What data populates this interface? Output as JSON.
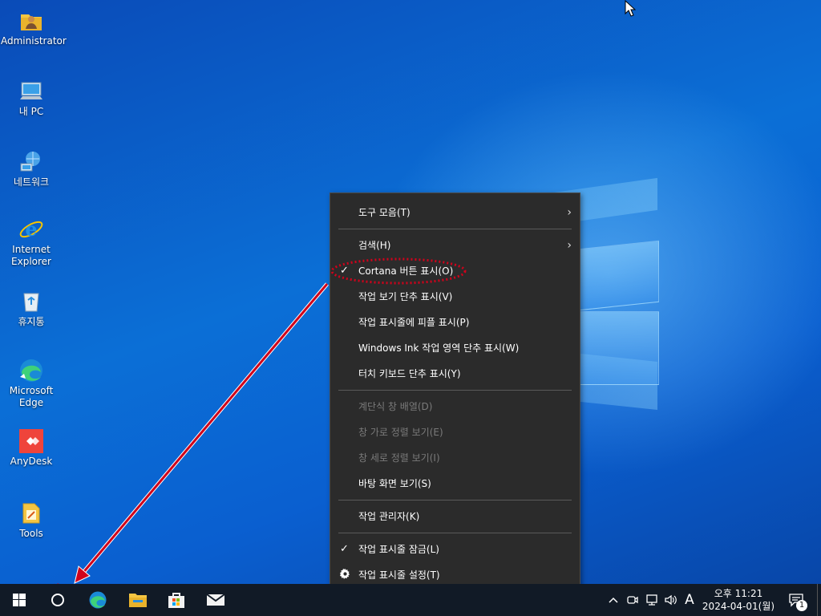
{
  "desktop": {
    "icons": [
      {
        "label_line1": "Administrator",
        "label_line2": "",
        "icon": "user-folder-icon"
      },
      {
        "label_line1": "내 PC",
        "label_line2": "",
        "icon": "computer-icon"
      },
      {
        "label_line1": "네트워크",
        "label_line2": "",
        "icon": "network-icon"
      },
      {
        "label_line1": "Internet",
        "label_line2": "Explorer",
        "icon": "internet-explorer-icon"
      },
      {
        "label_line1": "휴지통",
        "label_line2": "",
        "icon": "recycle-bin-icon"
      },
      {
        "label_line1": "Microsoft",
        "label_line2": "Edge",
        "icon": "edge-icon"
      },
      {
        "label_line1": "AnyDesk",
        "label_line2": "",
        "icon": "anydesk-icon"
      },
      {
        "label_line1": "Tools",
        "label_line2": "",
        "icon": "tools-folder-icon"
      }
    ]
  },
  "context_menu": {
    "items": [
      {
        "label": "도구 모음(T)",
        "submenu": true,
        "disabled": false,
        "checked": false
      },
      {
        "label": "검색(H)",
        "submenu": true,
        "disabled": false,
        "checked": false
      },
      {
        "label": "Cortana 버튼 표시(O)",
        "submenu": false,
        "disabled": false,
        "checked": true
      },
      {
        "label": "작업 보기 단추 표시(V)",
        "submenu": false,
        "disabled": false,
        "checked": false
      },
      {
        "label": "작업 표시줄에 피플 표시(P)",
        "submenu": false,
        "disabled": false,
        "checked": false
      },
      {
        "label": "Windows Ink 작업 영역 단추 표시(W)",
        "submenu": false,
        "disabled": false,
        "checked": false
      },
      {
        "label": "터치 키보드 단추 표시(Y)",
        "submenu": false,
        "disabled": false,
        "checked": false
      },
      {
        "label": "계단식 창 배열(D)",
        "submenu": false,
        "disabled": true,
        "checked": false
      },
      {
        "label": "창 가로 정렬 보기(E)",
        "submenu": false,
        "disabled": true,
        "checked": false
      },
      {
        "label": "창 세로 정렬 보기(I)",
        "submenu": false,
        "disabled": true,
        "checked": false
      },
      {
        "label": "바탕 화면 보기(S)",
        "submenu": false,
        "disabled": false,
        "checked": false
      },
      {
        "label": "작업 관리자(K)",
        "submenu": false,
        "disabled": false,
        "checked": false
      },
      {
        "label": "작업 표시줄 잠금(L)",
        "submenu": false,
        "disabled": false,
        "checked": true
      },
      {
        "label": "작업 표시줄 설정(T)",
        "submenu": false,
        "disabled": false,
        "checked": false,
        "icon": "gear-icon"
      }
    ],
    "checkmark": "✓",
    "submenu_arrow": "›"
  },
  "taskbar": {
    "apps": [
      "start-icon",
      "cortana-icon",
      "edge-icon",
      "file-explorer-icon",
      "store-icon",
      "mail-icon"
    ],
    "tray": {
      "ime": "A",
      "time": "오후 11:21",
      "date": "2024-04-01(월)",
      "notification_count": "1"
    }
  },
  "annotation": {
    "color": "#d0021b"
  },
  "colors": {
    "menu_bg": "#2b2b2b",
    "taskbar_bg": "#111a26",
    "accent": "#0a63c6"
  }
}
